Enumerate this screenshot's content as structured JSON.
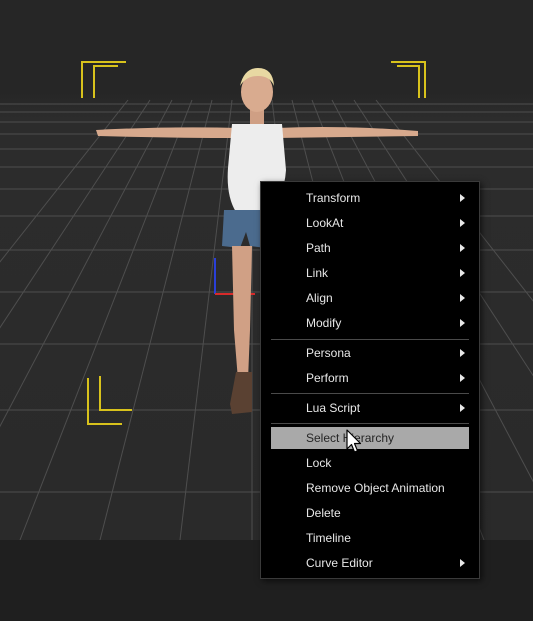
{
  "context_menu": {
    "items": [
      {
        "label": "Transform",
        "submenu": true
      },
      {
        "label": "LookAt",
        "submenu": true
      },
      {
        "label": "Path",
        "submenu": true
      },
      {
        "label": "Link",
        "submenu": true
      },
      {
        "label": "Align",
        "submenu": true
      },
      {
        "label": "Modify",
        "submenu": true
      },
      {
        "label": "Persona",
        "submenu": true
      },
      {
        "label": "Perform",
        "submenu": true
      },
      {
        "label": "Lua Script",
        "submenu": true
      },
      {
        "label": "Select Hierarchy",
        "submenu": false,
        "highlighted": true
      },
      {
        "label": "Lock",
        "submenu": false
      },
      {
        "label": "Remove Object Animation",
        "submenu": false
      },
      {
        "label": "Delete",
        "submenu": false
      },
      {
        "label": "Timeline",
        "submenu": false
      },
      {
        "label": "Curve Editor",
        "submenu": true
      }
    ]
  },
  "colors": {
    "menu_background": "#000000",
    "menu_text": "#e8e8e8",
    "highlight": "#a9a9a9",
    "viewport_background": "#262626",
    "grid_lines": "#555555",
    "selection_brackets": "#d8c21c"
  }
}
